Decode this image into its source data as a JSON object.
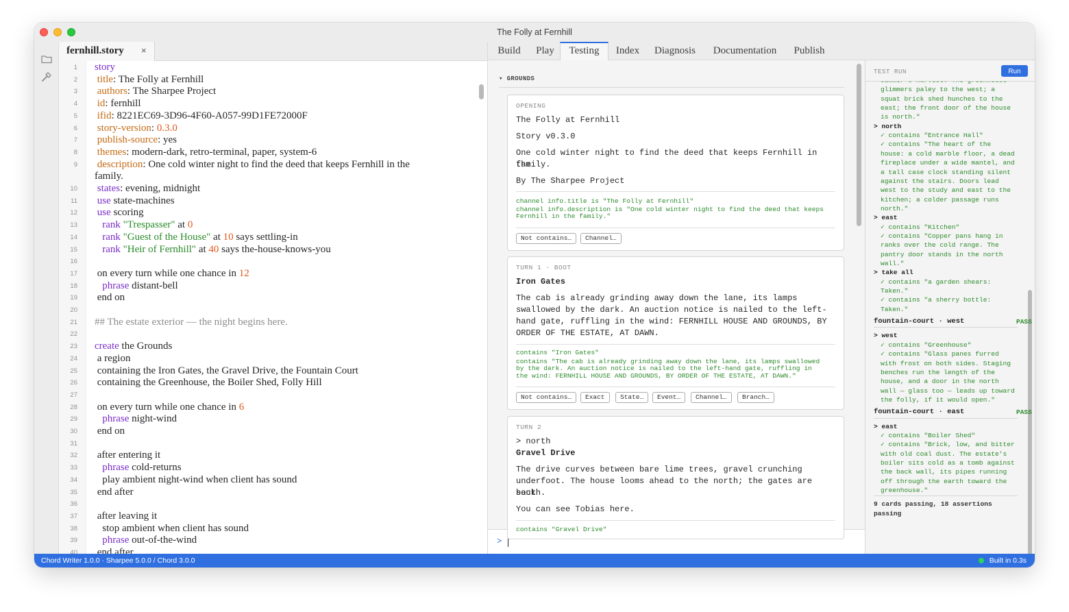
{
  "window": {
    "title": "The Folly at Fernhill"
  },
  "activity_bar": {
    "icons": [
      "folder-icon",
      "hammer-icon"
    ]
  },
  "file_tab": {
    "label": "fernhill.story",
    "close": "×"
  },
  "editor": {
    "lines": [
      [
        [
          "kw",
          "story"
        ]
      ],
      [
        [
          "",
          " "
        ],
        [
          "pr",
          "title"
        ],
        [
          "",
          ": The Folly at Fernhill"
        ]
      ],
      [
        [
          "",
          " "
        ],
        [
          "pr",
          "authors"
        ],
        [
          "",
          ": The Sharpee Project"
        ]
      ],
      [
        [
          "",
          " "
        ],
        [
          "pr",
          "id"
        ],
        [
          "",
          ": fernhill"
        ]
      ],
      [
        [
          "",
          " "
        ],
        [
          "pr",
          "ifid"
        ],
        [
          "",
          ": 8221EC69-3D96-4F60-A057-99D1FE72000F"
        ]
      ],
      [
        [
          "",
          " "
        ],
        [
          "pr",
          "story-version"
        ],
        [
          "",
          ": "
        ],
        [
          "num",
          "0.3.0"
        ]
      ],
      [
        [
          "",
          " "
        ],
        [
          "pr",
          "publish-source"
        ],
        [
          "",
          ": yes"
        ]
      ],
      [
        [
          "",
          " "
        ],
        [
          "pr",
          "themes"
        ],
        [
          "",
          ": modern-dark, retro-terminal, paper, system-6"
        ]
      ],
      [
        [
          "",
          " "
        ],
        [
          "pr",
          "description"
        ],
        [
          "",
          ": One cold winter night to find the deed that keeps Fernhill in the"
        ]
      ],
      [
        [
          "",
          " "
        ],
        [
          "kw",
          "states"
        ],
        [
          "",
          ": evening, midnight"
        ]
      ],
      [
        [
          "",
          " "
        ],
        [
          "kw",
          "use"
        ],
        [
          "",
          " state-machines"
        ]
      ],
      [
        [
          "",
          " "
        ],
        [
          "kw",
          "use"
        ],
        [
          "",
          " scoring"
        ]
      ],
      [
        [
          "",
          "   "
        ],
        [
          "kw",
          "rank"
        ],
        [
          "",
          " "
        ],
        [
          "str",
          "\"Trespasser\""
        ],
        [
          "",
          " at "
        ],
        [
          "num",
          "0"
        ]
      ],
      [
        [
          "",
          "   "
        ],
        [
          "kw",
          "rank"
        ],
        [
          "",
          " "
        ],
        [
          "str",
          "\"Guest of the House\""
        ],
        [
          "",
          " at "
        ],
        [
          "num",
          "10"
        ],
        [
          "",
          " says settling-in"
        ]
      ],
      [
        [
          "",
          "   "
        ],
        [
          "kw",
          "rank"
        ],
        [
          "",
          " "
        ],
        [
          "str",
          "\"Heir of Fernhill\""
        ],
        [
          "",
          " at "
        ],
        [
          "num",
          "40"
        ],
        [
          "",
          " says the-house-knows-you"
        ]
      ],
      [],
      [
        [
          "",
          " on every turn while one chance in "
        ],
        [
          "num",
          "12"
        ]
      ],
      [
        [
          "",
          "   "
        ],
        [
          "kw",
          "phrase"
        ],
        [
          "",
          " distant-bell"
        ]
      ],
      [
        [
          "",
          " end on"
        ]
      ],
      [],
      [
        [
          "cmt",
          "## The estate exterior — the night begins here."
        ]
      ],
      [],
      [
        [
          "kw",
          "create"
        ],
        [
          "",
          " the Grounds"
        ]
      ],
      [
        [
          "",
          " a region"
        ]
      ],
      [
        [
          "",
          " containing the Iron Gates, the Gravel Drive, the Fountain Court"
        ]
      ],
      [
        [
          "",
          " containing the Greenhouse, the Boiler Shed, Folly Hill"
        ]
      ],
      [],
      [
        [
          "",
          " on every turn while one chance in "
        ],
        [
          "num",
          "6"
        ]
      ],
      [
        [
          "",
          "   "
        ],
        [
          "kw",
          "phrase"
        ],
        [
          "",
          " night-wind"
        ]
      ],
      [
        [
          "",
          " end on"
        ]
      ],
      [],
      [
        [
          "",
          " after entering it"
        ]
      ],
      [
        [
          "",
          "   "
        ],
        [
          "kw",
          "phrase"
        ],
        [
          "",
          " cold-returns"
        ]
      ],
      [
        [
          "",
          "   play ambient night-wind when client has sound"
        ]
      ],
      [
        [
          "",
          " end after"
        ]
      ],
      [],
      [
        [
          "",
          " after leaving it"
        ]
      ],
      [
        [
          "",
          "   stop ambient when client has sound"
        ]
      ],
      [
        [
          "",
          "   "
        ],
        [
          "kw",
          "phrase"
        ],
        [
          "",
          " out-of-the-wind"
        ]
      ],
      [
        [
          "",
          " end after"
        ]
      ]
    ],
    "wrap_continuation": "family."
  },
  "tool_tabs": [
    "Build",
    "Play",
    "Testing",
    "Index",
    "Diagnosis",
    "Documentation",
    "Publish"
  ],
  "testing": {
    "section": "▾ GROUNDS",
    "cards": [
      {
        "label": "OPENING",
        "lines": [
          "The Folly at Fernhill",
          "Story v0.3.0",
          "One cold winter night to find the deed that keeps Fernhill in the",
          "family.",
          "By The Sharpee Project"
        ],
        "assertions": [
          "channel info.title is \"The Folly at Fernhill\"",
          "channel info.description is \"One cold winter night to find the deed that keeps",
          "Fernhill in the family.\""
        ],
        "chips": [
          "Not contains…",
          "Channel…"
        ]
      },
      {
        "label": "TURN 1 · BOOT",
        "title": "Iron Gates",
        "lines": [
          "The cab is already grinding away down the lane, its lamps",
          "swallowed by the dark. An auction notice is nailed to the left-",
          "hand gate, ruffling in the wind: FERNHILL HOUSE AND GROUNDS, BY",
          "ORDER OF THE ESTATE, AT DAWN."
        ],
        "assertions": [
          "contains \"Iron Gates\"",
          "contains \"The cab is already grinding away down the lane, its lamps swallowed",
          "by the dark. An auction notice is nailed to the left-hand gate, ruffling in",
          "the wind: FERNHILL HOUSE AND GROUNDS, BY ORDER OF THE ESTATE, AT DAWN.\""
        ],
        "chips": [
          "Not contains…",
          "Exact",
          "State…",
          "Event…",
          "Channel…",
          "Branch…"
        ]
      },
      {
        "label": "TURN 2",
        "command": "> north",
        "title": "Gravel Drive",
        "lines": [
          "The drive curves between bare lime trees, gravel crunching",
          "underfoot. The house looms ahead to the north; the gates are back",
          "south.",
          "You can see Tobias here."
        ],
        "assertions": [
          "contains \"Gravel Drive\""
        ]
      }
    ],
    "command_prompt": ">",
    "command_value": ""
  },
  "testrun": {
    "title": "TEST RUN",
    "run_label": "Run",
    "lines": [
      [
        "indent",
        "summer's harvest. The greenhouse"
      ],
      [
        "indent",
        "glimmers paley to the west; a"
      ],
      [
        "indent",
        "squat brick shed hunches to the"
      ],
      [
        "indent",
        "east; the front door of the house"
      ],
      [
        "indent",
        "is north.\""
      ],
      [
        "cmd",
        "> north"
      ],
      [
        "indent",
        "✓ contains \"Entrance Hall\""
      ],
      [
        "indent",
        "✓ contains \"The heart of the"
      ],
      [
        "indent",
        "house: a cold marble floor, a dead"
      ],
      [
        "indent",
        "fireplace under a wide mantel, and"
      ],
      [
        "indent",
        "a tall case clock standing silent"
      ],
      [
        "indent",
        "against the stairs. Doors lead"
      ],
      [
        "indent",
        "west to the study and east to the"
      ],
      [
        "indent",
        "kitchen; a colder passage runs"
      ],
      [
        "indent",
        "north.\""
      ],
      [
        "cmd",
        "> east"
      ],
      [
        "indent",
        "✓ contains \"Kitchen\""
      ],
      [
        "indent",
        "✓ contains \"Copper pans hang in"
      ],
      [
        "indent",
        "ranks over the cold range. The"
      ],
      [
        "indent",
        "pantry door stands in the north"
      ],
      [
        "indent",
        "wall.\""
      ],
      [
        "cmd",
        "> take all"
      ],
      [
        "indent",
        "✓ contains \"a garden shears:"
      ],
      [
        "indent",
        "Taken.\""
      ],
      [
        "indent",
        "✓ contains \"a sherry bottle:"
      ],
      [
        "indent",
        "Taken.\""
      ],
      [
        "case",
        "fountain-court · west",
        "PASS"
      ],
      [
        "rule"
      ],
      [
        "cmd",
        "> west"
      ],
      [
        "indent",
        "✓ contains \"Greenhouse\""
      ],
      [
        "indent",
        "✓ contains \"Glass panes furred"
      ],
      [
        "indent",
        "with frost on both sides. Staging"
      ],
      [
        "indent",
        "benches run the length of the"
      ],
      [
        "indent",
        "house, and a door in the north"
      ],
      [
        "indent",
        "wall — glass too — leads up toward"
      ],
      [
        "indent",
        "the folly, if it would open.\""
      ],
      [
        "case",
        "fountain-court · east",
        "PASS"
      ],
      [
        "rule"
      ],
      [
        "cmd",
        "> east"
      ],
      [
        "indent",
        "✓ contains \"Boiler Shed\""
      ],
      [
        "indent",
        "✓ contains \"Brick, low, and bitter"
      ],
      [
        "indent",
        "with old coal dust. The estate's"
      ],
      [
        "indent",
        "boiler sits cold as a tomb against"
      ],
      [
        "indent",
        "the back wall, its pipes running"
      ],
      [
        "indent",
        "off through the earth toward the"
      ],
      [
        "indent",
        "greenhouse.\""
      ],
      [
        "rule"
      ],
      [
        "summary",
        "9 cards passing, 18 assertions"
      ],
      [
        "summary",
        "passing"
      ]
    ]
  },
  "statusbar": {
    "left": "Chord Writer 1.0.0 · Sharpee 5.0.0 / Chord 3.0.0",
    "right": "Built in 0.3s"
  },
  "colors": {
    "accent": "#2f6fe0",
    "keyword": "#7a2dc7",
    "property": "#c46a12",
    "number": "#e0561b",
    "string": "#2a8a2a",
    "pass": "#2e8b2e"
  }
}
